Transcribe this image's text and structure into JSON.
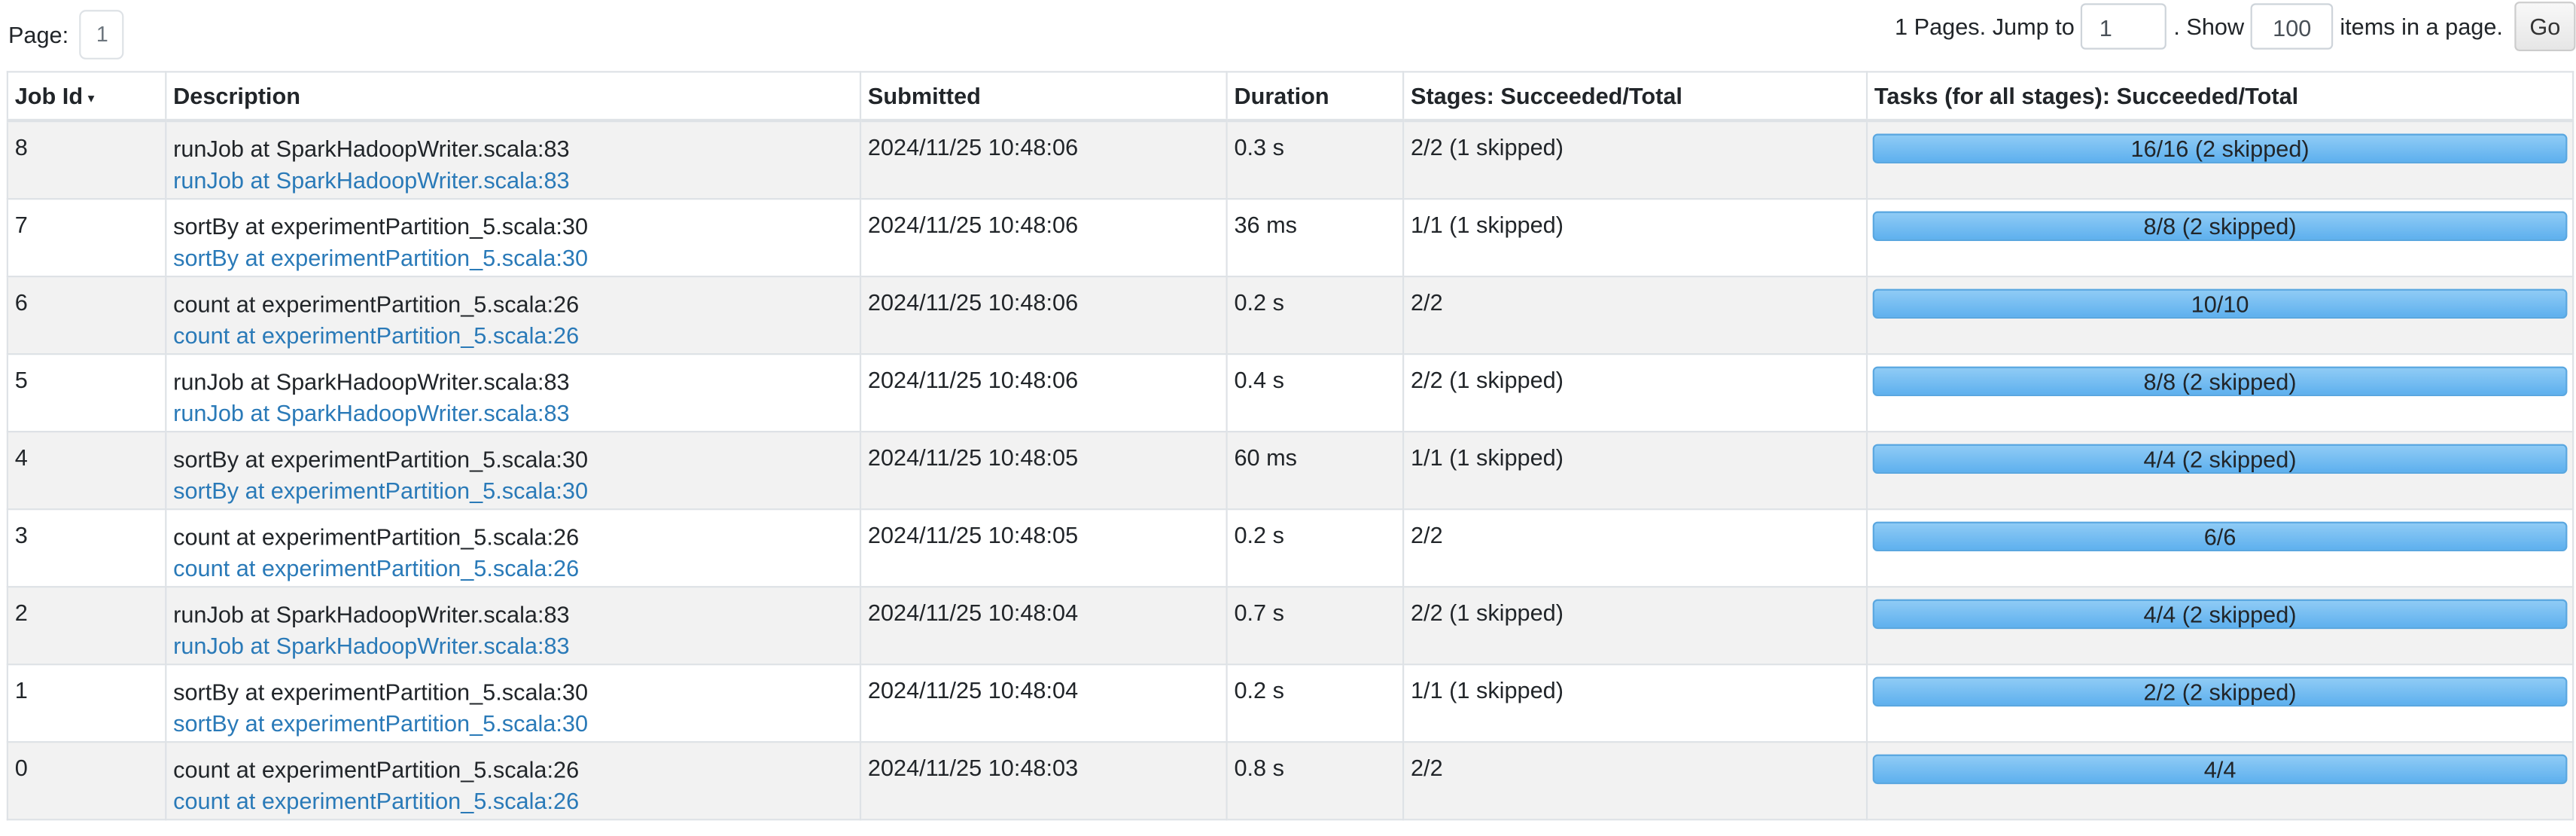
{
  "pager": {
    "page_label": "Page:",
    "current_page": "1",
    "pages_text": "1 Pages. Jump to",
    "jump_value": "1",
    "show_text": ". Show",
    "show_value": "100",
    "items_text": "items in a page.",
    "go_label": "Go"
  },
  "table": {
    "headers": {
      "job_id": "Job Id",
      "description": "Description",
      "submitted": "Submitted",
      "duration": "Duration",
      "stages": "Stages: Succeeded/Total",
      "tasks": "Tasks (for all stages): Succeeded/Total"
    },
    "sort_indicator": "▾",
    "rows": [
      {
        "id": "8",
        "desc": "runJob at SparkHadoopWriter.scala:83",
        "link": "runJob at SparkHadoopWriter.scala:83",
        "submitted": "2024/11/25 10:48:06",
        "duration": "0.3 s",
        "stages": "2/2 (1 skipped)",
        "tasks": "16/16 (2 skipped)",
        "progress": 1.0
      },
      {
        "id": "7",
        "desc": "sortBy at experimentPartition_5.scala:30",
        "link": "sortBy at experimentPartition_5.scala:30",
        "submitted": "2024/11/25 10:48:06",
        "duration": "36 ms",
        "stages": "1/1 (1 skipped)",
        "tasks": "8/8 (2 skipped)",
        "progress": 1.0
      },
      {
        "id": "6",
        "desc": "count at experimentPartition_5.scala:26",
        "link": "count at experimentPartition_5.scala:26",
        "submitted": "2024/11/25 10:48:06",
        "duration": "0.2 s",
        "stages": "2/2",
        "tasks": "10/10",
        "progress": 1.0
      },
      {
        "id": "5",
        "desc": "runJob at SparkHadoopWriter.scala:83",
        "link": "runJob at SparkHadoopWriter.scala:83",
        "submitted": "2024/11/25 10:48:06",
        "duration": "0.4 s",
        "stages": "2/2 (1 skipped)",
        "tasks": "8/8 (2 skipped)",
        "progress": 1.0
      },
      {
        "id": "4",
        "desc": "sortBy at experimentPartition_5.scala:30",
        "link": "sortBy at experimentPartition_5.scala:30",
        "submitted": "2024/11/25 10:48:05",
        "duration": "60 ms",
        "stages": "1/1 (1 skipped)",
        "tasks": "4/4 (2 skipped)",
        "progress": 1.0
      },
      {
        "id": "3",
        "desc": "count at experimentPartition_5.scala:26",
        "link": "count at experimentPartition_5.scala:26",
        "submitted": "2024/11/25 10:48:05",
        "duration": "0.2 s",
        "stages": "2/2",
        "tasks": "6/6",
        "progress": 1.0
      },
      {
        "id": "2",
        "desc": "runJob at SparkHadoopWriter.scala:83",
        "link": "runJob at SparkHadoopWriter.scala:83",
        "submitted": "2024/11/25 10:48:04",
        "duration": "0.7 s",
        "stages": "2/2 (1 skipped)",
        "tasks": "4/4 (2 skipped)",
        "progress": 1.0
      },
      {
        "id": "1",
        "desc": "sortBy at experimentPartition_5.scala:30",
        "link": "sortBy at experimentPartition_5.scala:30",
        "submitted": "2024/11/25 10:48:04",
        "duration": "0.2 s",
        "stages": "1/1 (1 skipped)",
        "tasks": "2/2 (2 skipped)",
        "progress": 1.0
      },
      {
        "id": "0",
        "desc": "count at experimentPartition_5.scala:26",
        "link": "count at experimentPartition_5.scala:26",
        "submitted": "2024/11/25 10:48:03",
        "duration": "0.8 s",
        "stages": "2/2",
        "tasks": "4/4",
        "progress": 1.0
      }
    ]
  },
  "colors": {
    "link": "#2a7ab8",
    "progress_bar": "#5eb0ee",
    "row_stripe": "#f2f2f2"
  }
}
